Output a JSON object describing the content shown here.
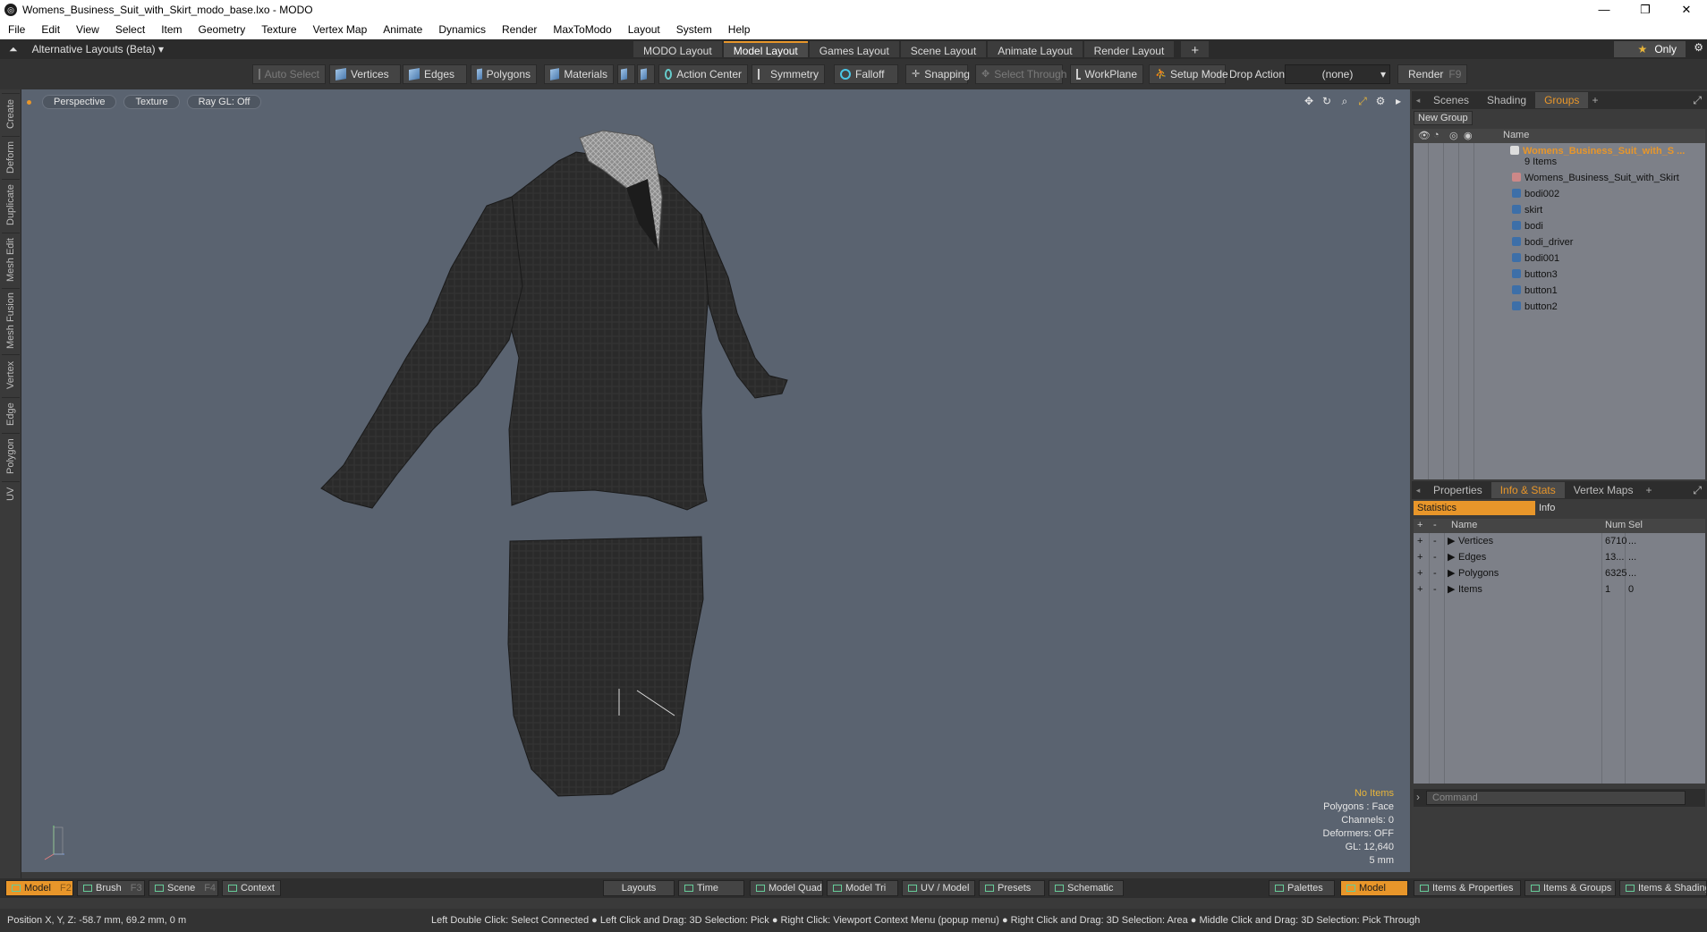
{
  "window": {
    "title": "Womens_Business_Suit_with_Skirt_modo_base.lxo - MODO",
    "app_icon": "modo-logo-icon"
  },
  "menu": [
    "File",
    "Edit",
    "View",
    "Select",
    "Item",
    "Geometry",
    "Texture",
    "Vertex Map",
    "Animate",
    "Dynamics",
    "Render",
    "MaxToModo",
    "Layout",
    "System",
    "Help"
  ],
  "layoutbar": {
    "alt_layouts": "Alternative Layouts (Beta) ▾",
    "tabs": [
      "MODO Layout",
      "Model Layout",
      "Games Layout",
      "Scene Layout",
      "Animate Layout",
      "Render Layout"
    ],
    "active_tab": "Model Layout",
    "only": "Only"
  },
  "toolbar": {
    "auto_select": "Auto Select",
    "vertices": "Vertices",
    "edges": "Edges",
    "polygons": "Polygons",
    "materials": "Materials",
    "action_center": "Action Center",
    "symmetry": "Symmetry",
    "falloff": "Falloff",
    "snapping": "Snapping",
    "select_through": "Select Through",
    "workplane": "WorkPlane",
    "setup_mode": "Setup Mode",
    "drop_action": "Drop Action",
    "drop_value": "(none)",
    "render": "Render",
    "render_key": "F9"
  },
  "left_tabs": [
    "Create",
    "Deform",
    "Duplicate",
    "Mesh Edit",
    "Mesh Fusion",
    "Vertex",
    "Edge",
    "Polygon",
    "UV"
  ],
  "viewport": {
    "view": "Perspective",
    "shading": "Texture",
    "raygl": "Ray GL: Off",
    "stats": {
      "items": "No Items",
      "polygons": "Polygons : Face",
      "channels": "Channels: 0",
      "deformers": "Deformers: OFF",
      "gl": "GL: 12,640",
      "scale": "5 mm"
    }
  },
  "groups_panel": {
    "tabs": [
      "Scenes",
      "Shading",
      "Groups"
    ],
    "active_tab": "Groups",
    "new_group": "New Group",
    "column_name": "Name",
    "root": "Womens_Business_Suit_with_S ...",
    "root_count": "9 Items",
    "children": [
      "Womens_Business_Suit_with_Skirt",
      "bodi002",
      "skirt",
      "bodi",
      "bodi_driver",
      "bodi001",
      "button3",
      "button1",
      "button2"
    ]
  },
  "properties_panel": {
    "tabs": [
      "Properties",
      "Info & Stats",
      "Vertex Maps"
    ],
    "active_tab": "Info & Stats",
    "statistics": "Statistics",
    "info": "Info",
    "columns": {
      "name": "Name",
      "num": "Num",
      "sel": "Sel"
    },
    "rows": [
      {
        "name": "Vertices",
        "num": "6710",
        "sel": "..."
      },
      {
        "name": "Edges",
        "num": "13...",
        "sel": "..."
      },
      {
        "name": "Polygons",
        "num": "6325",
        "sel": "..."
      },
      {
        "name": "Items",
        "num": "1",
        "sel": "0"
      }
    ],
    "command_placeholder": "Command"
  },
  "bottombar": {
    "model": "Model",
    "model_key": "F2",
    "brush": "Brush",
    "brush_key": "F3",
    "scene": "Scene",
    "scene_key": "F4",
    "context": "Context",
    "layouts": "Layouts",
    "time": "Time",
    "model_quad": "Model Quad",
    "model_tri": "Model Tri",
    "uv_model": "UV / Model",
    "presets": "Presets",
    "schematic": "Schematic",
    "palettes": "Palettes",
    "model_right": "Model",
    "items_properties": "Items & Properties",
    "items_groups": "Items & Groups",
    "items_shading": "Items & Shading"
  },
  "statusbar": {
    "position": "Position X, Y, Z:   -58.7 mm, 69.2 mm, 0 m",
    "hint": "Left Double Click: Select Connected ● Left Click and Drag: 3D Selection: Pick ● Right Click: Viewport Context Menu (popup menu) ● Right Click and Drag: 3D Selection: Area ● Middle Click and Drag: 3D Selection: Pick Through"
  },
  "colors": {
    "accent": "#e8962a",
    "viewport_bg": "#5a6370",
    "panel_list_bg": "#7d8088"
  }
}
